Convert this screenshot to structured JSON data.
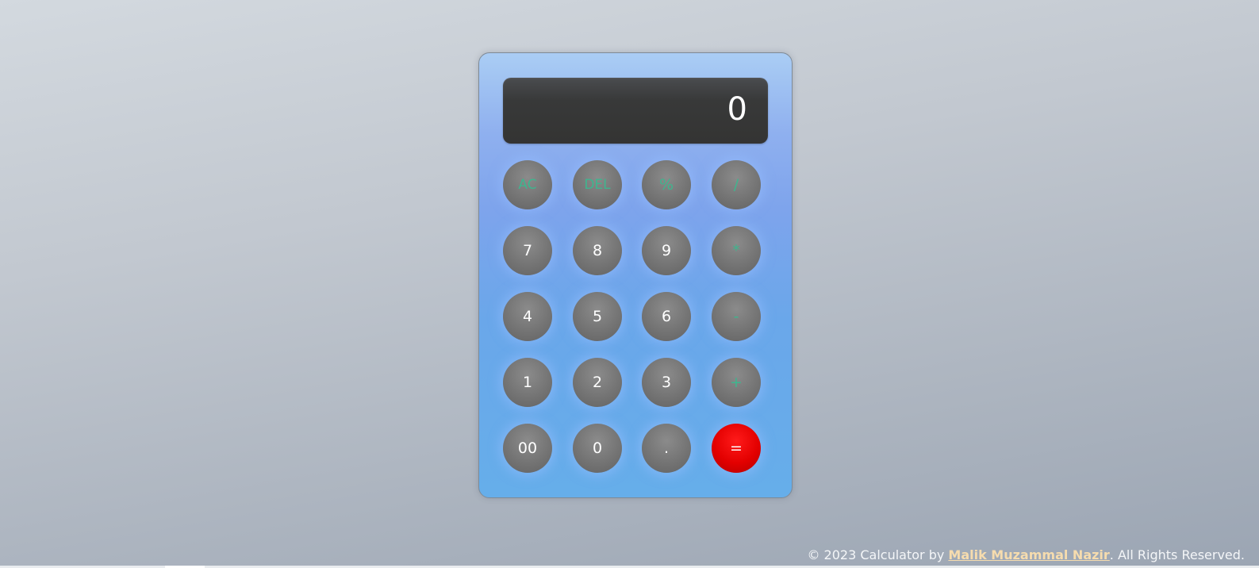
{
  "display": {
    "value": "0"
  },
  "keys": [
    [
      "AC",
      "DEL",
      "%",
      "/"
    ],
    [
      "7",
      "8",
      "9",
      "*"
    ],
    [
      "4",
      "5",
      "6",
      "-"
    ],
    [
      "1",
      "2",
      "3",
      "+"
    ],
    [
      "00",
      "0",
      ".",
      "="
    ]
  ],
  "footer": {
    "prefix": "© 2023 Calculator by ",
    "author_link": "Malik Muzammal Nazir",
    "suffix": ". All Rights Reserved."
  },
  "colors": {
    "operator_text": "#3fb58e",
    "equals_bg": "#e30000",
    "author_link": "#f6dcae"
  }
}
